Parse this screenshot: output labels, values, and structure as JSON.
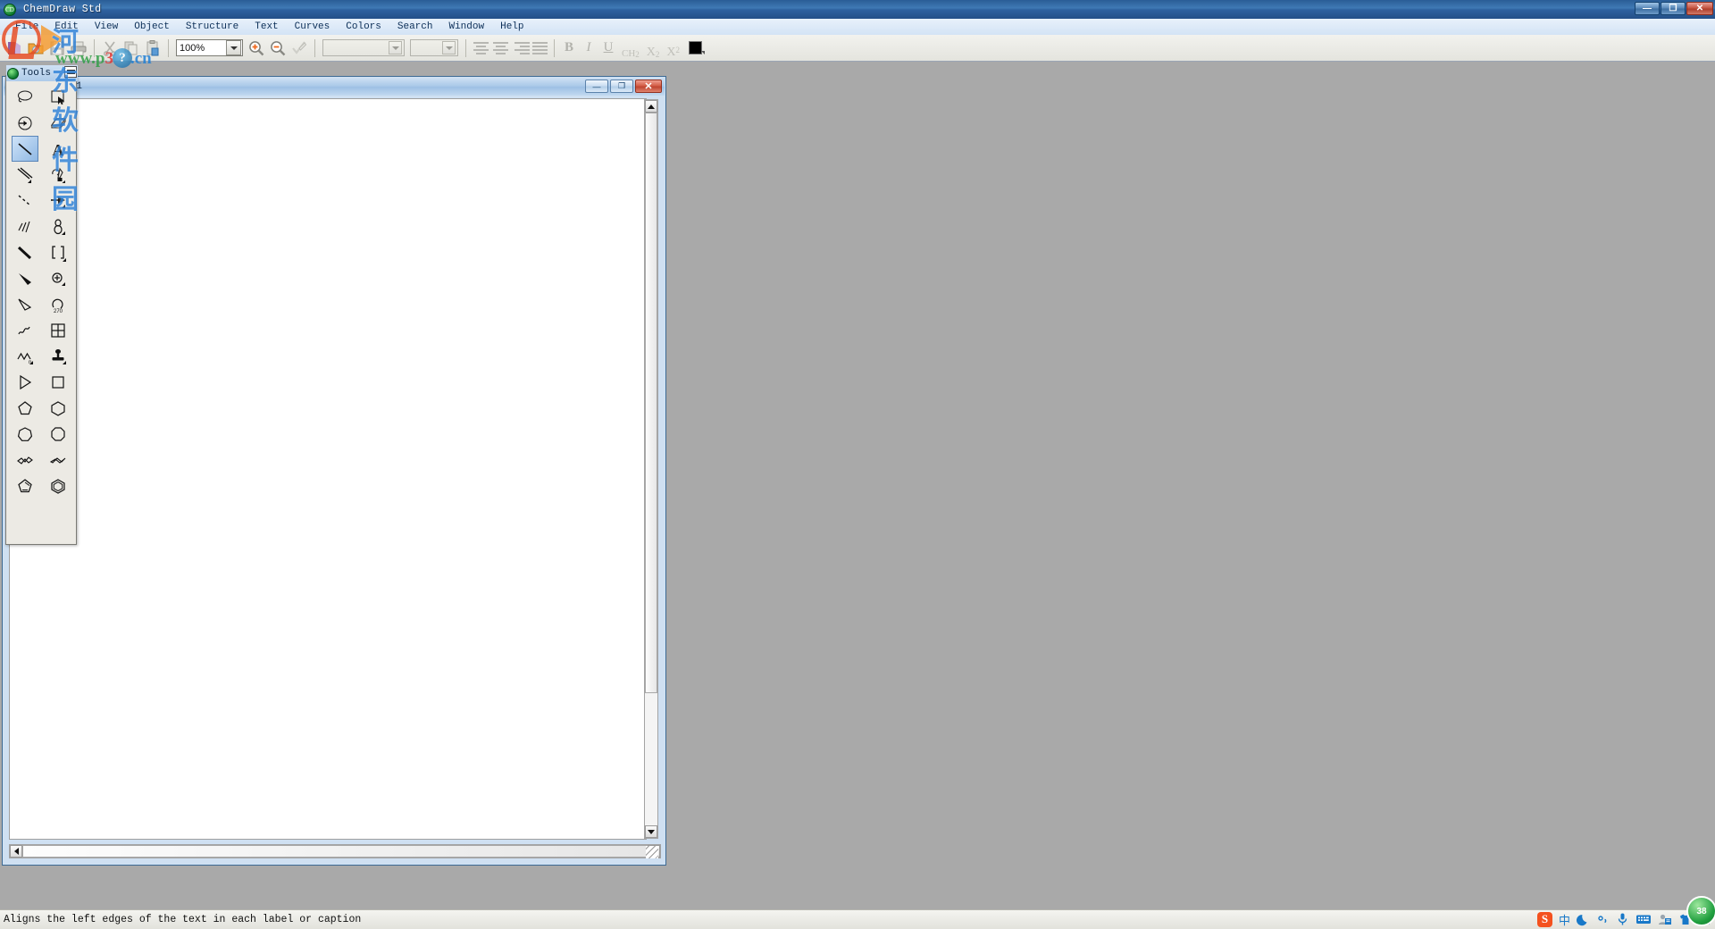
{
  "app": {
    "title": "ChemDraw Std",
    "icon": "chemdraw-logo-icon",
    "window_buttons": [
      {
        "name": "minimize",
        "glyph": "—"
      },
      {
        "name": "restore",
        "glyph": "❐"
      },
      {
        "name": "close",
        "glyph": "✕"
      }
    ]
  },
  "menubar": {
    "items": [
      {
        "label": "File"
      },
      {
        "label": "Edit"
      },
      {
        "label": "View"
      },
      {
        "label": "Object"
      },
      {
        "label": "Structure"
      },
      {
        "label": "Text"
      },
      {
        "label": "Curves"
      },
      {
        "label": "Colors"
      },
      {
        "label": "Search"
      },
      {
        "label": "Window"
      },
      {
        "label": "Help"
      }
    ]
  },
  "toolbar": {
    "new_label": "New",
    "open_label": "Open",
    "save_label": "Save",
    "print_label": "Print",
    "cut_label": "Cut",
    "copy_label": "Copy",
    "paste_label": "Paste",
    "zoom_value": "100%",
    "zoom_placeholder": "100%",
    "zoom_in_label": "Zoom In",
    "zoom_out_label": "Zoom Out",
    "spellcheck_label": "Check Spelling",
    "font_value": "",
    "font_placeholder": "",
    "size_value": "",
    "size_placeholder": "",
    "align_left_label": "Align Left",
    "align_center_label": "Align Center",
    "align_right_label": "Align Right",
    "align_justify_label": "Justify",
    "bold_label": "B",
    "italic_label": "I",
    "underline_label": "U",
    "formula_main": "CH",
    "formula_sub": "2",
    "subscript_main": "X",
    "subscript_sub": "2",
    "superscript_main": "X",
    "superscript_sup": "2",
    "color_swatch": "#000000"
  },
  "tools_palette": {
    "title": "Tools",
    "close_label": "Close",
    "selected_index": 4,
    "tools": [
      {
        "name": "lasso-select-tool",
        "label": "Lasso Select"
      },
      {
        "name": "marquee-select-tool",
        "label": "Marquee Select"
      },
      {
        "name": "eraser-tool",
        "label": "Eraser"
      },
      {
        "name": "rectangle-eraser-tool",
        "label": "Eraser Block"
      },
      {
        "name": "solid-bond-tool",
        "label": "Solid Bond"
      },
      {
        "name": "text-tool",
        "label": "Text"
      },
      {
        "name": "multiple-bond-tool",
        "label": "Multiple Bond"
      },
      {
        "name": "pen-tool",
        "label": "Pen"
      },
      {
        "name": "dashed-bond-tool",
        "label": "Dashed Bond"
      },
      {
        "name": "arrow-tool",
        "label": "Arrow"
      },
      {
        "name": "hashed-bond-tool",
        "label": "Hashed Bond"
      },
      {
        "name": "orbital-tool",
        "label": "Orbital"
      },
      {
        "name": "bold-bond-tool",
        "label": "Bold Bond"
      },
      {
        "name": "bracket-tool",
        "label": "Bracket"
      },
      {
        "name": "wedged-bond-tool",
        "label": "Wedged Bond"
      },
      {
        "name": "charge-tool",
        "label": "Charge"
      },
      {
        "name": "hollow-wedge-bond-tool",
        "label": "Hollow Wedge Bond"
      },
      {
        "name": "arc-270-tool",
        "label": "Arc 270"
      },
      {
        "name": "squiggle-bond-tool",
        "label": "Squiggle Bond"
      },
      {
        "name": "table-tool",
        "label": "Table"
      },
      {
        "name": "chain-tool",
        "label": "Chain"
      },
      {
        "name": "tlc-plate-tool",
        "label": "TLC Plate"
      },
      {
        "name": "acyclic-chain-tool",
        "label": "Acyclic Chain"
      },
      {
        "name": "cyclobutane-tool",
        "label": "Cyclobutane"
      },
      {
        "name": "cyclopentane-tool",
        "label": "Cyclopentane"
      },
      {
        "name": "cyclohexane-tool",
        "label": "Cyclohexane"
      },
      {
        "name": "cycloheptane-tool",
        "label": "Cycloheptane"
      },
      {
        "name": "cyclooctane-tool",
        "label": "Cyclooctane"
      },
      {
        "name": "chair-ring-tool",
        "label": "Chair Ring"
      },
      {
        "name": "chair-ring-alt-tool",
        "label": "Chair Ring Alt"
      },
      {
        "name": "cyclopentadiene-tool",
        "label": "Cyclopentadiene"
      },
      {
        "name": "benzene-tool",
        "label": "Benzene"
      }
    ]
  },
  "document": {
    "title": "Document-1",
    "sysmenu_label": "System Menu",
    "buttons": [
      {
        "name": "minimize",
        "glyph": "—"
      },
      {
        "name": "restore",
        "glyph": "❐"
      },
      {
        "name": "close",
        "glyph": "✕"
      }
    ]
  },
  "statusbar": {
    "message": "Aligns the left edges of the text in each label or caption"
  },
  "tray": {
    "items": [
      {
        "name": "sogou-ime-icon",
        "label": "S"
      },
      {
        "name": "chinese-input-mode-icon",
        "label": "中"
      },
      {
        "name": "moon-icon",
        "label": "☾"
      },
      {
        "name": "punctuation-mode-icon",
        "label": "°,"
      },
      {
        "name": "microphone-icon",
        "label": "Voice Input"
      },
      {
        "name": "soft-keyboard-icon",
        "label": "Soft Keyboard"
      },
      {
        "name": "user-panel-icon",
        "label": "User Panel"
      },
      {
        "name": "skin-icon",
        "label": "Skin"
      },
      {
        "name": "toolbox-icon",
        "label": "Toolbox"
      }
    ],
    "badge_value": "38"
  },
  "watermark": {
    "site_cn": "河东软件园",
    "url_www": "www.",
    "url_p": "p",
    "url_num": "359",
    "url_cn": ".cn",
    "q_letter": "?"
  }
}
